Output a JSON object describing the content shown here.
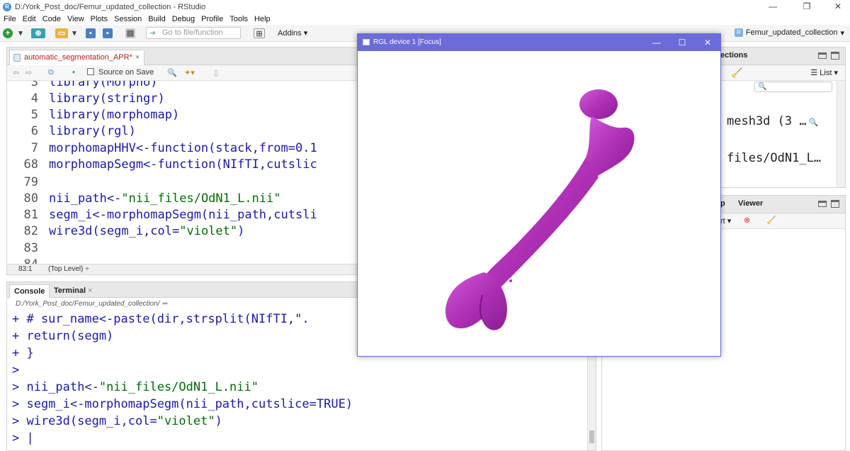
{
  "window": {
    "title": "D:/York_Post_doc/Femur_updated_collection - RStudio"
  },
  "menu": [
    "File",
    "Edit",
    "Code",
    "View",
    "Plots",
    "Session",
    "Build",
    "Debug",
    "Profile",
    "Tools",
    "Help"
  ],
  "toolbar": {
    "goto_placeholder": "Go to file/function",
    "addins_label": "Addins",
    "project_label": "Femur_updated_collection"
  },
  "editor": {
    "tab_label": "automatic_segmentation_APR*",
    "source_on_save": "Source on Save",
    "lines": [
      {
        "num": "3",
        "pre": "library(Morpho)",
        "str": "",
        "post": ""
      },
      {
        "num": "4",
        "pre": "library(stringr)",
        "str": "",
        "post": ""
      },
      {
        "num": "5",
        "pre": "library(morphomap)",
        "str": "",
        "post": ""
      },
      {
        "num": "6",
        "pre": "library(rgl)",
        "str": "",
        "post": ""
      },
      {
        "num": "7",
        "pre": "morphomapHHV<-function(stack,from=0.1",
        "str": "",
        "post": ""
      },
      {
        "num": "68",
        "pre": "morphomapSegm<-function(NIfTI,cutslic",
        "str": "",
        "post": ""
      },
      {
        "num": "79",
        "pre": "",
        "str": "",
        "post": ""
      },
      {
        "num": "80",
        "pre": "nii_path<-",
        "str": "\"nii_files/OdN1_L.nii\"",
        "post": ""
      },
      {
        "num": "81",
        "pre": "segm_i<-morphomapSegm(nii_path,cutsli",
        "str": "",
        "post": ""
      },
      {
        "num": "82",
        "pre": "wire3d(segm_i,col=",
        "str": "\"violet\"",
        "post": ")"
      },
      {
        "num": "83",
        "pre": "",
        "str": "",
        "post": ""
      },
      {
        "num": "84",
        "pre": "",
        "str": "",
        "post": ""
      }
    ],
    "status_position": "83:1",
    "status_scope": "(Top Level) ÷"
  },
  "console": {
    "tabs": [
      "Console",
      "Terminal"
    ],
    "path": "D:/York_Post_doc/Femur_updated_collection/",
    "lines": [
      {
        "pre": "+ # sur_name<-paste(dir,strsplit(NIfTI,\".",
        "str": "",
        "post": ""
      },
      {
        "pre": "+ return(segm)",
        "str": "",
        "post": ""
      },
      {
        "pre": "+ }",
        "str": "",
        "post": ""
      },
      {
        "pre": ">",
        "str": "",
        "post": ""
      },
      {
        "pre": "> nii_path<-",
        "str": "\"nii_files/OdN1_L.nii\"",
        "post": ""
      },
      {
        "pre": "> segm_i<-morphomapSegm(nii_path,cutslice=TRUE)",
        "str": "",
        "post": ""
      },
      {
        "pre": "> wire3d(segm_i,col=",
        "str": "\"violet\"",
        "post": ")"
      },
      {
        "pre": "> |",
        "str": "",
        "post": ""
      }
    ]
  },
  "env_pane": {
    "tab_fragment": "ections",
    "list_label": "List ▾",
    "row1": "mesh3d (3 …",
    "row2": "files/OdN1_L…"
  },
  "files_pane": {
    "tab_fragment": "p",
    "viewer_tab": "Viewer",
    "tool_fragment": "rt ▾"
  },
  "rgl": {
    "title": "RGL device 1 [Focus]",
    "mesh_color": "#b030b8"
  }
}
